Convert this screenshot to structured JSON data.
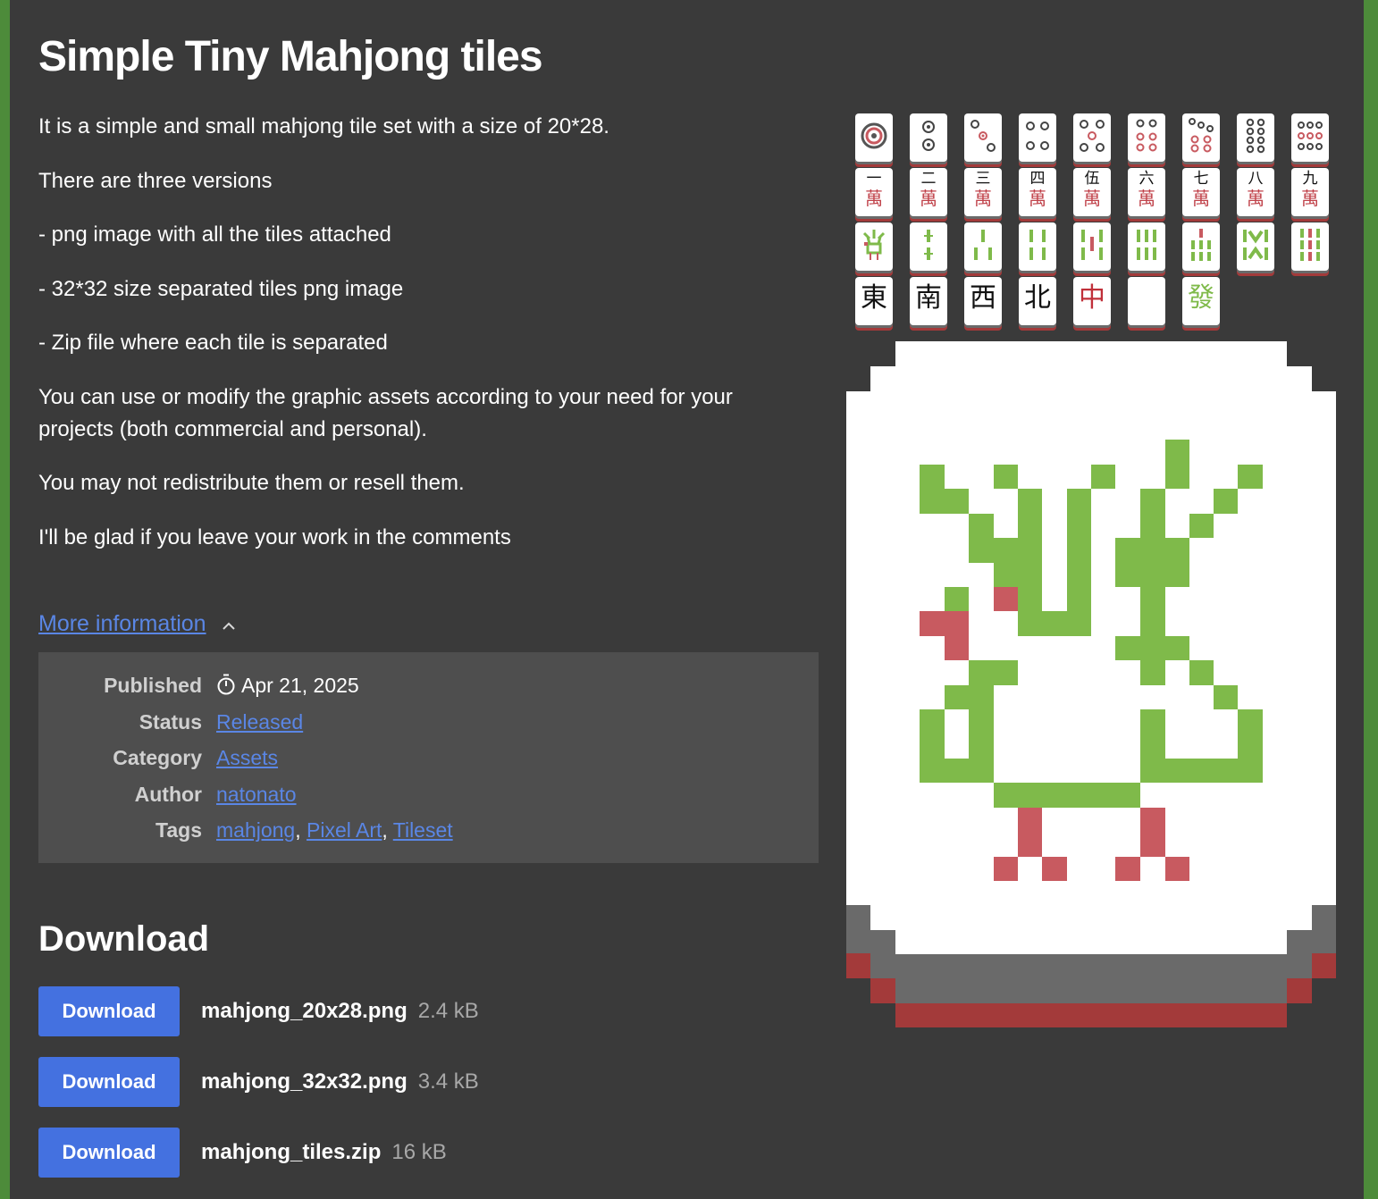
{
  "page": {
    "title": "Simple Tiny Mahjong tiles",
    "description": [
      "It is a simple and small mahjong tile set with a size of 20*28.",
      "There are three versions",
      "- png image with all the tiles attached",
      "- 32*32 size separated tiles png image",
      "- Zip file where each tile is separated",
      "You can use or modify the graphic assets according to your need for your projects (both commercial and personal).",
      "You may not redistribute them or resell them.",
      "I'll be glad if you leave your work in the comments"
    ],
    "more_info_label": "More information"
  },
  "info": {
    "published_label": "Published",
    "published_value": "Apr 21, 2025",
    "status_label": "Status",
    "status_value": "Released",
    "category_label": "Category",
    "category_value": "Assets",
    "author_label": "Author",
    "author_value": "natonato",
    "tags_label": "Tags",
    "tags": [
      "mahjong",
      "Pixel Art",
      "Tileset"
    ]
  },
  "download": {
    "title": "Download",
    "files": [
      {
        "button": "Download",
        "name": "mahjong_20x28.png",
        "size": "2.4 kB"
      },
      {
        "button": "Download",
        "name": "mahjong_32x32.png",
        "size": "3.4 kB"
      },
      {
        "button": "Download",
        "name": "mahjong_tiles.zip",
        "size": "16 kB"
      }
    ]
  },
  "tiles": {
    "man_numerals": [
      "一",
      "二",
      "三",
      "四",
      "伍",
      "六",
      "七",
      "八",
      "九"
    ],
    "man_char": "萬",
    "honors": [
      "東",
      "南",
      "西",
      "北",
      "中",
      "",
      "發"
    ]
  },
  "colors": {
    "background": "#3a3a3a",
    "frame": "#4d8b3a",
    "info_box": "#4e4e4e",
    "link": "#5a86e5",
    "button": "#4471e0",
    "tile_green": "#7fba4a",
    "tile_red": "#c85a60"
  }
}
